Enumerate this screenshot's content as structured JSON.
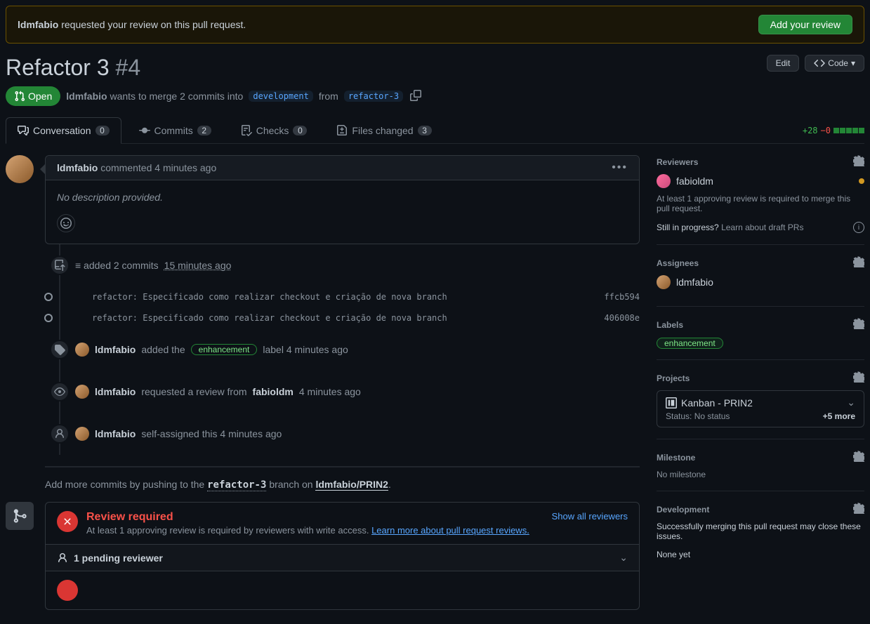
{
  "banner": {
    "author": "ldmfabio",
    "text": "requested your review on this pull request.",
    "button": "Add your review"
  },
  "pr": {
    "title": "Refactor 3",
    "number": "#4",
    "edit": "Edit",
    "code": "Code",
    "state": "Open",
    "author": "ldmfabio",
    "merge_text_1": "wants to merge 2 commits into",
    "base": "development",
    "from": "from",
    "head": "refactor-3"
  },
  "tabs": {
    "conversation": {
      "label": "Conversation",
      "count": "0"
    },
    "commits": {
      "label": "Commits",
      "count": "2"
    },
    "checks": {
      "label": "Checks",
      "count": "0"
    },
    "files": {
      "label": "Files changed",
      "count": "3"
    }
  },
  "diffstat": {
    "additions": "+28",
    "deletions": "−0"
  },
  "comment": {
    "author": "ldmfabio",
    "action": "commented",
    "time": "4 minutes ago",
    "body": "No description provided."
  },
  "commits_push": {
    "prefix": "≡ added 2 commits",
    "time": "15 minutes ago"
  },
  "commit_list": [
    {
      "msg": "refactor: Especificado como realizar checkout e criação de nova branch",
      "sha": "ffcb594"
    },
    {
      "msg": "refactor: Especificado como realizar checkout e criação de nova branch",
      "sha": "406008e"
    }
  ],
  "events": {
    "label": {
      "author": "ldmfabio",
      "action": "added the",
      "label": "enhancement",
      "suffix": "label 4 minutes ago"
    },
    "review_req": {
      "author": "ldmfabio",
      "action": "requested a review from",
      "target": "fabioldm",
      "time": "4 minutes ago"
    },
    "assign": {
      "author": "ldmfabio",
      "action": "self-assigned this 4 minutes ago"
    }
  },
  "push_hint": {
    "prefix": "Add more commits by pushing to the",
    "branch": "refactor-3",
    "middle": "branch on",
    "repo": "ldmfabio/PRIN2"
  },
  "merge": {
    "review_title": "Review required",
    "review_desc": "At least 1 approving review is required by reviewers with write access.",
    "review_link": "Learn more about pull request reviews.",
    "show_all": "Show all reviewers",
    "pending": "1 pending reviewer"
  },
  "sidebar": {
    "reviewers": {
      "title": "Reviewers",
      "name": "fabioldm",
      "note": "At least 1 approving review is required to merge this pull request.",
      "draft_q": "Still in progress?",
      "draft_link": "Learn about draft PRs"
    },
    "assignees": {
      "title": "Assignees",
      "name": "ldmfabio"
    },
    "labels": {
      "title": "Labels",
      "label": "enhancement"
    },
    "projects": {
      "title": "Projects",
      "name": "Kanban - PRIN2",
      "status": "Status: No status",
      "more": "+5 more"
    },
    "milestone": {
      "title": "Milestone",
      "none": "No milestone"
    },
    "development": {
      "title": "Development",
      "text": "Successfully merging this pull request may close these issues.",
      "none": "None yet"
    }
  }
}
